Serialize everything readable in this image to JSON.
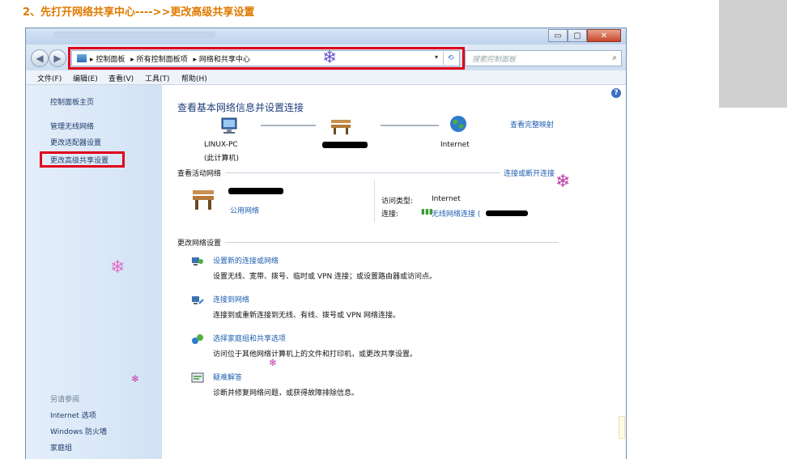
{
  "caption": "2、先打开网络共享中心---->>更改高级共享设置",
  "window": {
    "buttons": {
      "minimize": "▭",
      "maximize": "▢",
      "close": "✕"
    },
    "nav": {
      "back": "◀",
      "forward": "▶"
    },
    "address": {
      "crumbs": [
        "▸ 控制面板",
        "▸ 所有控制面板项",
        "▸ 网络和共享中心"
      ],
      "dropdown": "▾",
      "refresh": "⟲"
    },
    "search": {
      "placeholder": "搜索控制面板",
      "icon": "⌕"
    },
    "menu": [
      "文件(F)",
      "编辑(E)",
      "查看(V)",
      "工具(T)",
      "帮助(H)"
    ]
  },
  "sidebar": {
    "home": "控制面板主页",
    "links": [
      "管理无线网络",
      "更改适配器设置",
      "更改高级共享设置"
    ],
    "see_also_title": "另请参阅",
    "see_also": [
      "Internet 选项",
      "Windows 防火墙",
      "家庭组"
    ]
  },
  "main": {
    "help": "?",
    "heading": "查看基本网络信息并设置连接",
    "view_full_map": "查看完整映射",
    "nodes": {
      "pc_name": "LINUX-PC",
      "pc_sub": "(此计算机)",
      "internet": "Internet"
    },
    "active_section": "查看活动网络",
    "connect_disconnect": "连接或断开连接",
    "network_type": "公用网络",
    "access_type_label": "访问类型:",
    "access_type_value": "Internet",
    "connection_label": "连接:",
    "connection_value": "无线网络连接 (",
    "change_section": "更改网络设置",
    "tasks": [
      {
        "title": "设置新的连接或网络",
        "desc": "设置无线、宽带、拨号、临时或 VPN 连接；或设置路由器或访问点。",
        "icon": "setup-connection-icon"
      },
      {
        "title": "连接到网络",
        "desc": "连接到或重新连接到无线、有线、拨号或 VPN 网络连接。",
        "icon": "connect-network-icon"
      },
      {
        "title": "选择家庭组和共享选项",
        "desc": "访问位于其他网络计算机上的文件和打印机，或更改共享设置。",
        "icon": "homegroup-icon"
      },
      {
        "title": "疑难解答",
        "desc": "诊断并修复网络问题，或获得故障排除信息。",
        "icon": "troubleshoot-icon"
      }
    ]
  },
  "decor": {
    "snowflake": "❄",
    "colors": {
      "highlight": "#e0001b",
      "caption": "#e07a00",
      "link": "#1f5fb0",
      "snow": "#c03aa8"
    }
  }
}
